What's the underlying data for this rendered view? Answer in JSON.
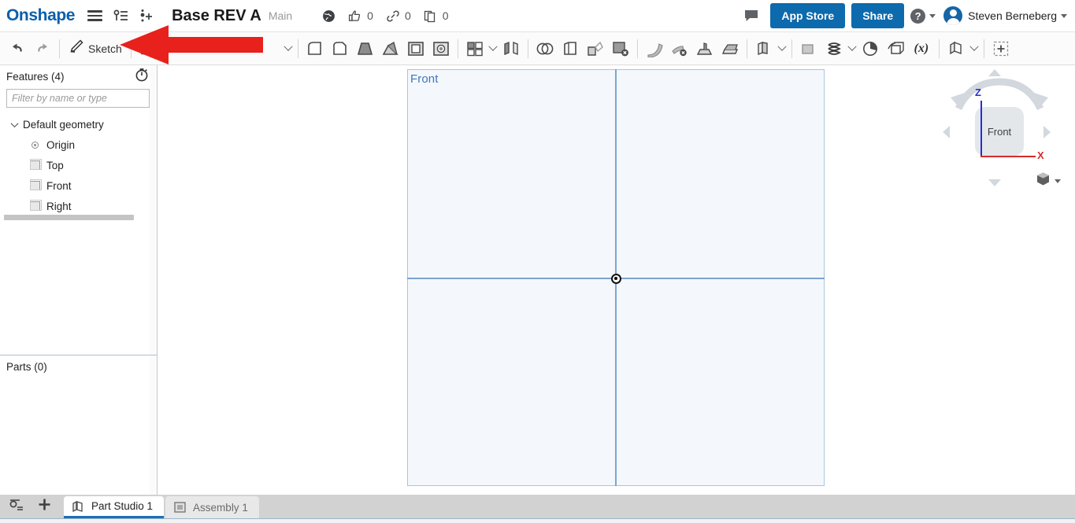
{
  "app": {
    "name": "Onshape",
    "brand_color": "#0b5faa"
  },
  "topbar": {
    "logo": "Onshape",
    "menu_icon": "hamburger-menu-icon",
    "versions_icon": "version-graph-icon",
    "branch_icon": "branch-add-icon",
    "document_title": "Base REV A",
    "workspace": "Main",
    "public_icon": "globe-icon",
    "counters": [
      {
        "icon": "thumbs-up-icon",
        "value": "0"
      },
      {
        "icon": "link-icon",
        "value": "0"
      },
      {
        "icon": "copy-icon",
        "value": "0"
      }
    ],
    "comment_icon": "comment-bubble-icon",
    "app_store_label": "App Store",
    "share_label": "Share",
    "help_label": "?",
    "user_name": "Steven Berneberg"
  },
  "toolbar": {
    "undo_icon": "undo-arrow-icon",
    "redo_icon": "redo-arrow-icon",
    "sketch_label": "Sketch",
    "sketch_icon": "sketch-pencil-icon",
    "plane_tool_icon": "sketch-plane-icon",
    "overflow_caret_icon": "chevron-down-icon",
    "tools": [
      {
        "icon": "extrude-icon"
      },
      {
        "icon": "revolve-icon"
      },
      {
        "icon": "sweep-icon"
      },
      {
        "icon": "loft-icon"
      },
      {
        "icon": "thicken-icon"
      },
      {
        "icon": "hole-icon"
      },
      {
        "icon": "pattern-icon"
      },
      {
        "icon": "mirror-icon"
      },
      {
        "icon": "boolean-icon"
      },
      {
        "icon": "shell-icon"
      },
      {
        "icon": "draft-icon"
      },
      {
        "icon": "delete-face-icon"
      },
      {
        "icon": "fillet-icon"
      },
      {
        "icon": "chamfer-icon"
      },
      {
        "icon": "rib-icon"
      },
      {
        "icon": "split-icon"
      },
      {
        "icon": "sheet-metal-icon"
      },
      {
        "icon": "plane-icon"
      },
      {
        "icon": "helix-icon"
      },
      {
        "icon": "curve-icon"
      },
      {
        "icon": "transform-icon"
      },
      {
        "icon": "variable-icon"
      },
      {
        "icon": "derived-part-icon"
      },
      {
        "icon": "add-custom-feature-icon"
      }
    ]
  },
  "annotation": {
    "arrow": "red-pointer-arrow",
    "color": "#e8211c"
  },
  "features_panel": {
    "title": "Features (4)",
    "history_icon": "rollback-timer-icon",
    "filter_placeholder": "Filter by name or type",
    "filter_value": "",
    "tree": {
      "group_label": "Default geometry",
      "items": [
        {
          "label": "Origin",
          "icon": "origin-point-icon"
        },
        {
          "label": "Top",
          "icon": "plane-icon"
        },
        {
          "label": "Front",
          "icon": "plane-icon"
        },
        {
          "label": "Right",
          "icon": "plane-icon"
        }
      ]
    }
  },
  "parts_panel": {
    "title": "Parts (0)"
  },
  "graphics": {
    "selected_plane_label": "Front",
    "plane_fill": "#f4f8fc",
    "plane_border": "#a8c4e0",
    "axis_color": "#7ba4d0",
    "origin_marker": "origin-point-marker"
  },
  "view_cube": {
    "face_label": "Front",
    "axis_z_label": "Z",
    "axis_x_label": "X",
    "axis_z_color": "#2b2bd6",
    "axis_x_color": "#d62b2b",
    "display_mode_icon": "shaded-cube-icon"
  },
  "tabbar": {
    "filter_icon": "tab-search-icon",
    "add_icon": "add-tab-icon",
    "tabs": [
      {
        "label": "Part Studio 1",
        "icon": "part-studio-icon",
        "active": true
      },
      {
        "label": "Assembly 1",
        "icon": "assembly-icon",
        "active": false
      }
    ]
  }
}
